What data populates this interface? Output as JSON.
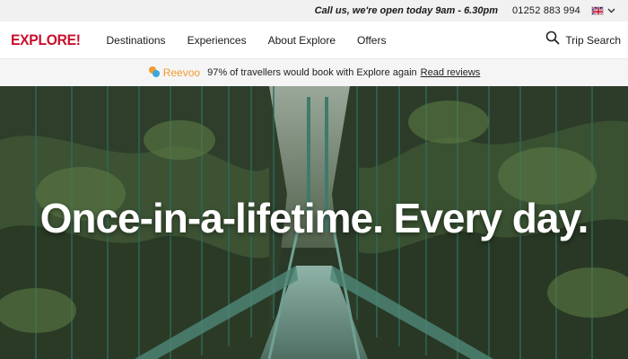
{
  "topbar": {
    "hours": "Call us, we're open today 9am - 6.30pm",
    "phone": "01252 883 994",
    "flag_icon": "uk-flag-icon",
    "chevron_icon": "chevron-down-icon"
  },
  "nav": {
    "logo": "EXPLORE!",
    "links": [
      "Destinations",
      "Experiences",
      "About Explore",
      "Offers"
    ],
    "search_label": "Trip Search",
    "search_icon": "search-icon"
  },
  "reevoo": {
    "brand": "Reevoo",
    "message": "97% of travellers would book with Explore again",
    "link": "Read reviews"
  },
  "hero": {
    "title": "Once-in-a-lifetime. Every day."
  },
  "colors": {
    "brand_red": "#c8102e",
    "reevoo_orange": "#f29a2e",
    "topbar_bg": "#f1f1f1"
  }
}
